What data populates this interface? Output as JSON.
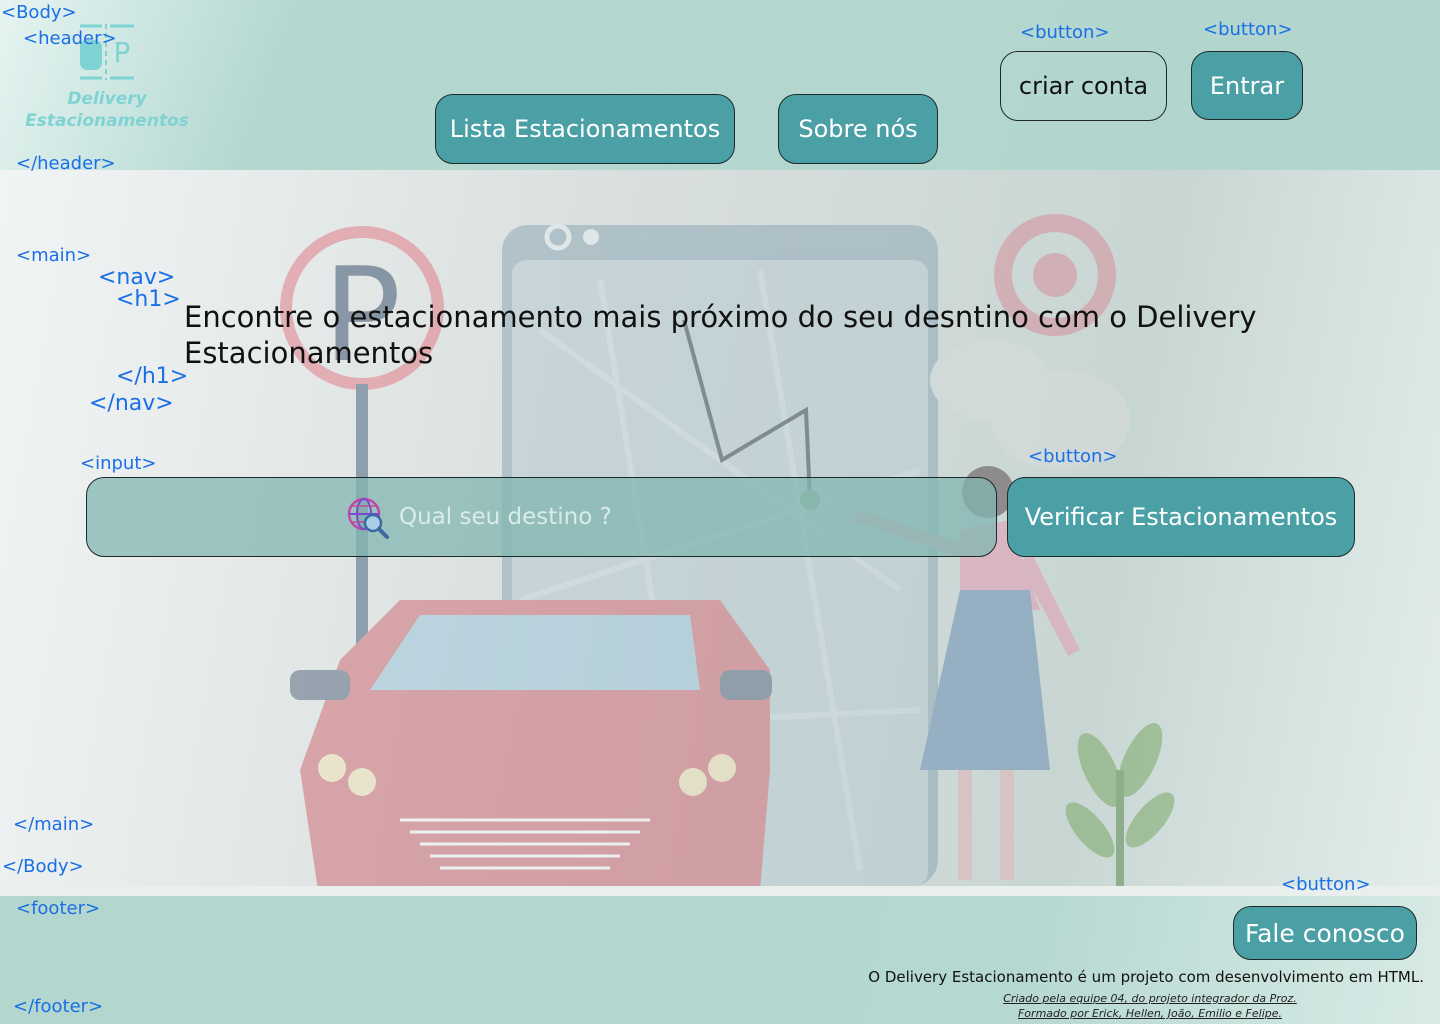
{
  "tags": {
    "body_open": "<Body>",
    "header_open": "<header>",
    "header_close": "</header>",
    "button_criar": "<button>",
    "button_entrar": "<button>",
    "main_open": "<main>",
    "nav_open": "<nav>",
    "h1_open": "<h1>",
    "h1_close": "</h1>",
    "nav_close": "</nav>",
    "input_open": "<input>",
    "button_verificar": "<button>",
    "main_close": "</main>",
    "body_close": "</Body>",
    "footer_open": "<footer>",
    "button_fale": "<button>",
    "footer_close": "</footer>"
  },
  "header": {
    "logo_line1": "Delivery",
    "logo_line2": "Estacionamentos",
    "logo_letter": "P",
    "nav": {
      "lista": "Lista Estacionamentos",
      "sobre": "Sobre nós"
    },
    "criar_conta": "criar conta",
    "entrar": "Entrar"
  },
  "main": {
    "headline": "Encontre o estacionamento mais próximo do seu desntino com o Delivery Estacionamentos",
    "search": {
      "placeholder": "Qual seu destino ?",
      "icon": "globe-search-icon"
    },
    "verificar": "Verificar Estacionamentos"
  },
  "footer": {
    "fale_conosco": "Fale conosco",
    "about": "O Delivery Estacionamento é um projeto com desenvolvimento em HTML.",
    "credit_1": "Criado pela equipe 04, do projeto integrador da Proz.",
    "credit_2": "Formado por Erick, Hellen, João, Emilio e Felipe."
  },
  "colors": {
    "accent_teal": "#4aa0a5",
    "tag_blue": "#1a6fe6",
    "logo_cyan": "#7fd3d3"
  }
}
